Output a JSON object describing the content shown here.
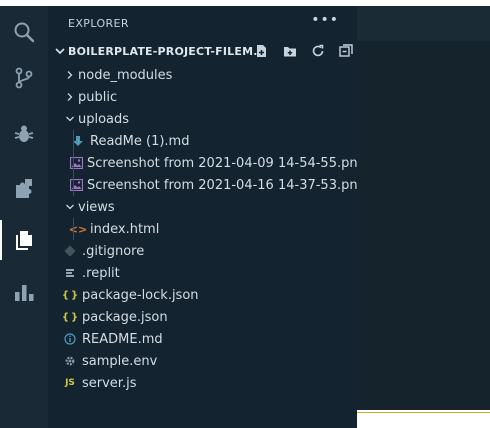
{
  "explorer": {
    "title": "EXPLORER",
    "more_actions": "•••",
    "section": {
      "title": "BOILERPLATE-PROJECT-FILEM..."
    }
  },
  "activity_bar": {
    "items": [
      "search-icon",
      "source-control-icon",
      "debug-icon",
      "extensions-icon",
      "files-icon",
      "stats-icon"
    ],
    "active": "files-icon"
  },
  "tree": [
    {
      "label": "node_modules",
      "type": "folder",
      "expanded": false
    },
    {
      "label": "public",
      "type": "folder",
      "expanded": false
    },
    {
      "label": "uploads",
      "type": "folder",
      "expanded": true
    },
    {
      "label": "ReadMe (1).md",
      "type": "download-file"
    },
    {
      "label": "Screenshot from 2021-04-09 14-54-55.png",
      "type": "image-file"
    },
    {
      "label": "Screenshot from 2021-04-16 14-37-53.png",
      "type": "image-file"
    },
    {
      "label": "views",
      "type": "folder",
      "expanded": true
    },
    {
      "label": "index.html",
      "type": "html-file"
    },
    {
      "label": ".gitignore",
      "type": "git-file"
    },
    {
      "label": ".replit",
      "type": "text-file"
    },
    {
      "label": "package-lock.json",
      "type": "json-file"
    },
    {
      "label": "package.json",
      "type": "json-file"
    },
    {
      "label": "README.md",
      "type": "info-file"
    },
    {
      "label": "sample.env",
      "type": "gear-file"
    },
    {
      "label": "server.js",
      "type": "js-file"
    }
  ],
  "colors": {
    "activity_bg": "#192a36",
    "sidebar_bg": "#13232f",
    "json_icon": "#cbcb41",
    "html_icon": "#e37933",
    "js_icon": "#cbcb41",
    "image_icon": "#a074c4",
    "download_icon": "#519aba",
    "info_icon": "#519aba",
    "accent": "#c8a81f"
  }
}
